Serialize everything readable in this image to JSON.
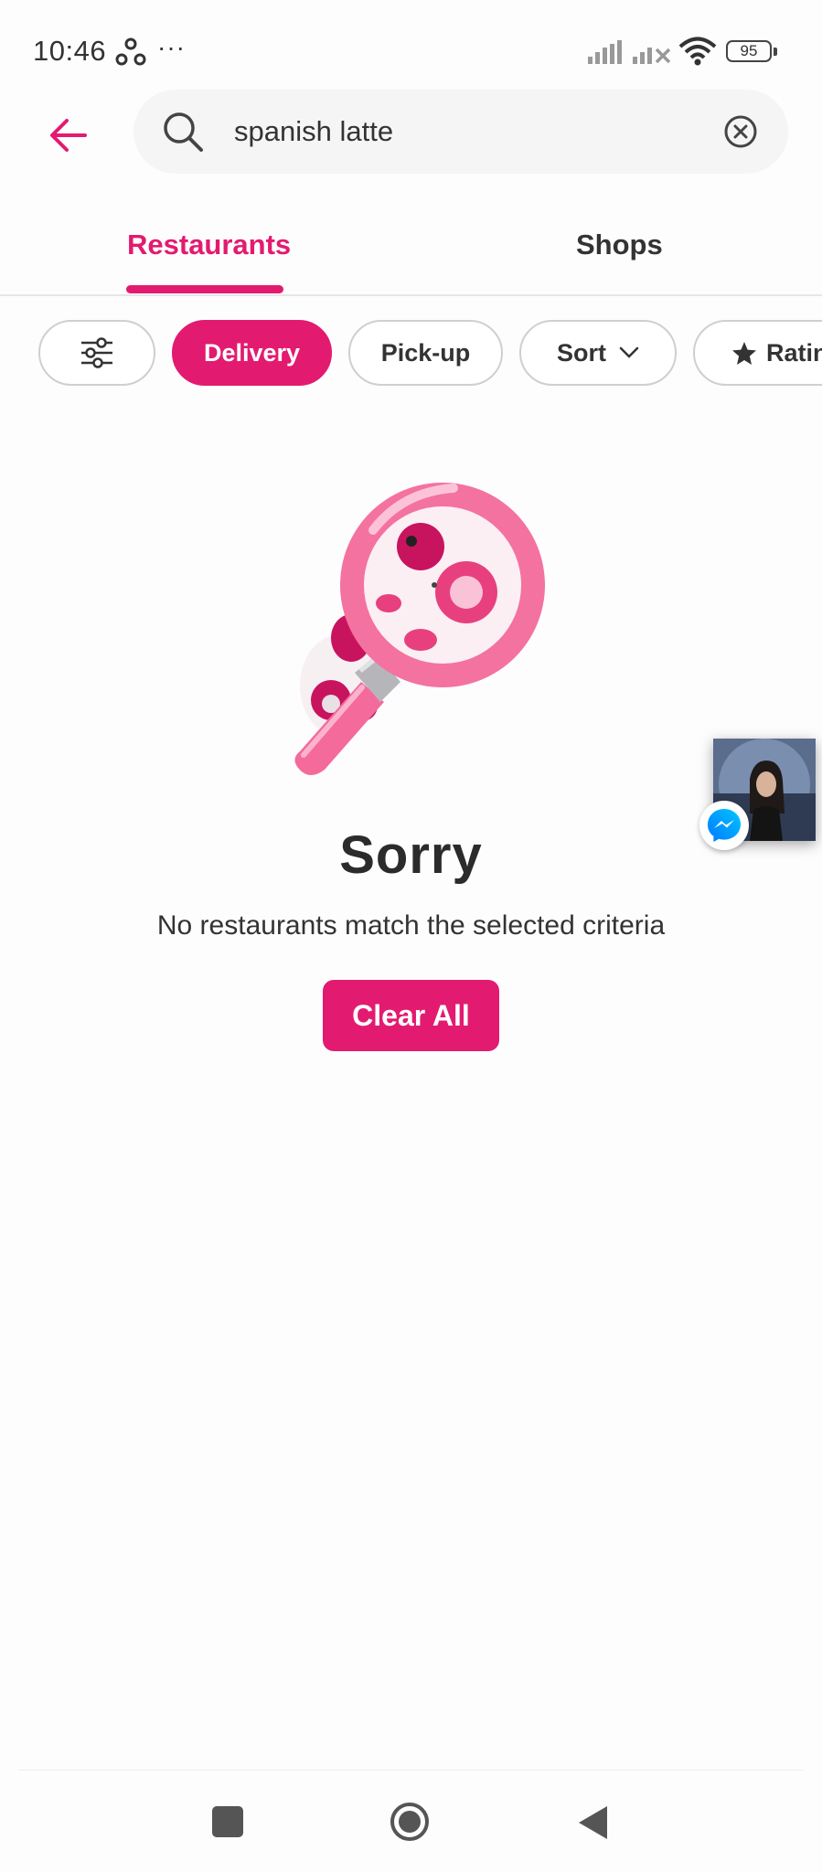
{
  "status_bar": {
    "time": "10:46",
    "dots": "···",
    "battery": "95"
  },
  "header": {
    "search": {
      "value": "spanish latte",
      "placeholder": ""
    }
  },
  "tabs": [
    {
      "label": "Restaurants",
      "active": true
    },
    {
      "label": "Shops",
      "active": false
    }
  ],
  "filters": {
    "filter_icon": "sliders-icon",
    "chips": [
      {
        "label": "Delivery",
        "selected": true
      },
      {
        "label": "Pick-up",
        "selected": false
      },
      {
        "label": "Sort",
        "selected": false
      },
      {
        "label": "Ratin",
        "selected": false
      }
    ]
  },
  "empty_state": {
    "title": "Sorry",
    "message": "No restaurants match the selected criteria",
    "clear_button": "Clear All"
  },
  "colors": {
    "brand": "#e21b70",
    "chip_border": "#cfcfcf",
    "text": "#333333"
  },
  "icons": [
    "back-arrow-icon",
    "search-icon",
    "clear-circle-icon",
    "sliders-icon",
    "chevron-down-icon",
    "star-icon",
    "messenger-icon",
    "panda-magnifier-illustration"
  ]
}
